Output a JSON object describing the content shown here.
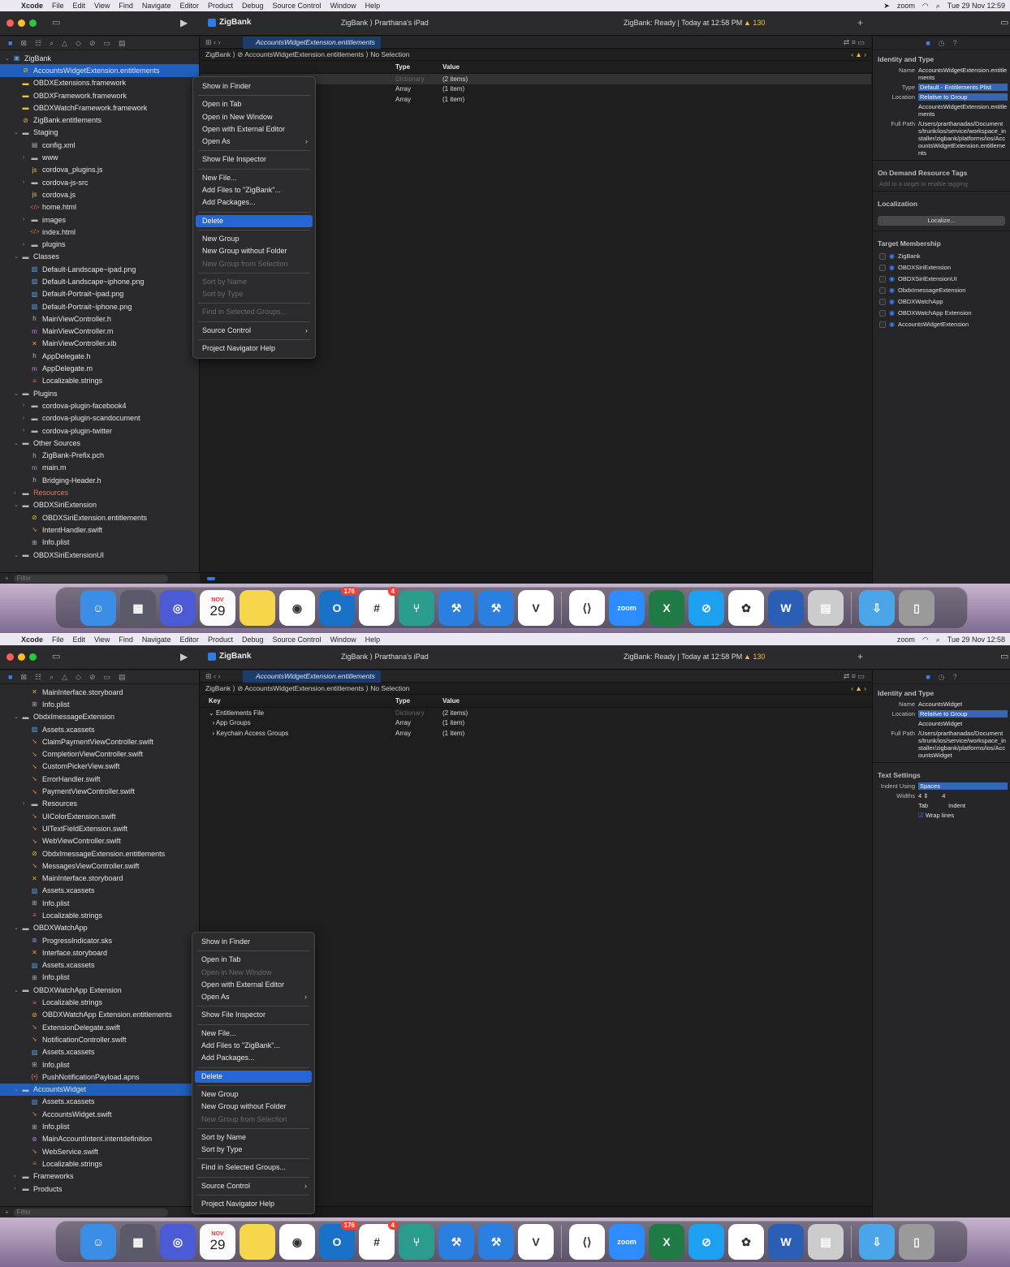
{
  "menubar": {
    "apple": "",
    "app": "Xcode",
    "items": [
      "File",
      "Edit",
      "View",
      "Find",
      "Navigate",
      "Editor",
      "Product",
      "Debug",
      "Source Control",
      "Window",
      "Help"
    ],
    "zoom": "zoom",
    "clock1": "Tue 29 Nov 12:59",
    "clock2": "Tue 29 Nov 12:58"
  },
  "toolbar": {
    "project": "ZigBank",
    "scheme": "ZigBank",
    "device": "Prarthana's iPad",
    "status": "ZigBank: Ready | Today at 12:58 PM",
    "warnings": "130"
  },
  "editor": {
    "tab": "AccountsWidgetExtension.entitlements",
    "jump": "ZigBank ⟩ ⊘ AccountsWidgetExtension.entitlements ⟩ No Selection",
    "headers": {
      "key": "Key",
      "type": "Type",
      "value": "Value"
    },
    "rows": [
      {
        "key": "Entitlements File",
        "type": "Dictionary",
        "value": "(2 items)"
      },
      {
        "key": "App Groups",
        "type": "Array",
        "value": "(1 item)"
      },
      {
        "key": "Keychain Access Groups",
        "type": "Array",
        "value": "(1 item)"
      }
    ]
  },
  "nav1": [
    {
      "t": "ZigBank",
      "i": "proj",
      "d": 0,
      "ar": "v"
    },
    {
      "t": "AccountsWidgetExtension.entitlements",
      "i": "ent",
      "d": 1,
      "sel": true
    },
    {
      "t": "OBDXExtensions.framework",
      "i": "fw",
      "d": 1
    },
    {
      "t": "OBDXFramework.framework",
      "i": "fw",
      "d": 1
    },
    {
      "t": "OBDXWatchFramework.framework",
      "i": "fw",
      "d": 1
    },
    {
      "t": "ZigBank.entitlements",
      "i": "ent",
      "d": 1
    },
    {
      "t": "Staging",
      "i": "fold",
      "d": 1,
      "ar": "v"
    },
    {
      "t": "config.xml",
      "i": "xml",
      "d": 2
    },
    {
      "t": "www",
      "i": "fold",
      "d": 2,
      "ar": ">"
    },
    {
      "t": "cordova_plugins.js",
      "i": "js",
      "d": 2
    },
    {
      "t": "cordova-js-src",
      "i": "fold",
      "d": 2,
      "ar": ">"
    },
    {
      "t": "cordova.js",
      "i": "js",
      "d": 2
    },
    {
      "t": "home.html",
      "i": "html",
      "d": 2
    },
    {
      "t": "images",
      "i": "fold",
      "d": 2,
      "ar": ">"
    },
    {
      "t": "index.html",
      "i": "html",
      "d": 2
    },
    {
      "t": "plugins",
      "i": "fold",
      "d": 2,
      "ar": ">"
    },
    {
      "t": "Classes",
      "i": "fold",
      "d": 1,
      "ar": "v"
    },
    {
      "t": "Default-Landscape~ipad.png",
      "i": "img",
      "d": 2
    },
    {
      "t": "Default-Landscape~iphone.png",
      "i": "img",
      "d": 2
    },
    {
      "t": "Default-Portrait~ipad.png",
      "i": "img",
      "d": 2
    },
    {
      "t": "Default-Portrait~iphone.png",
      "i": "img",
      "d": 2
    },
    {
      "t": "MainViewController.h",
      "i": "h",
      "d": 2
    },
    {
      "t": "MainViewController.m",
      "i": "m",
      "d": 2
    },
    {
      "t": "MainViewController.xib",
      "i": "x",
      "d": 2
    },
    {
      "t": "AppDelegate.h",
      "i": "h",
      "d": 2
    },
    {
      "t": "AppDelegate.m",
      "i": "m",
      "d": 2
    },
    {
      "t": "Localizable.strings",
      "i": "str",
      "d": 2
    },
    {
      "t": "Plugins",
      "i": "fold",
      "d": 1,
      "ar": "v"
    },
    {
      "t": "cordova-plugin-facebook4",
      "i": "fold",
      "d": 2,
      "ar": ">"
    },
    {
      "t": "cordova-plugin-scandocument",
      "i": "fold",
      "d": 2,
      "ar": ">"
    },
    {
      "t": "cordova-plugin-twitter",
      "i": "fold",
      "d": 2,
      "ar": ">"
    },
    {
      "t": "Other Sources",
      "i": "fold",
      "d": 1,
      "ar": "v"
    },
    {
      "t": "ZigBank-Prefix.pch",
      "i": "h",
      "d": 2
    },
    {
      "t": "main.m",
      "i": "m",
      "d": 2
    },
    {
      "t": "Bridging-Header.h",
      "i": "h",
      "d": 2
    },
    {
      "t": "Resources",
      "i": "fold",
      "d": 1,
      "ar": ">",
      "red": true
    },
    {
      "t": "OBDXSiriExtension",
      "i": "fold",
      "d": 1,
      "ar": "v"
    },
    {
      "t": "OBDXSiriExtension.entitlements",
      "i": "ent",
      "d": 2
    },
    {
      "t": "IntentHandler.swift",
      "i": "sw",
      "d": 2
    },
    {
      "t": "Info.plist",
      "i": "plist",
      "d": 2
    },
    {
      "t": "OBDXSiriExtensionUI",
      "i": "fold",
      "d": 1,
      "ar": "v"
    }
  ],
  "nav2": [
    {
      "t": "MainInterface.storyboard",
      "i": "x",
      "d": 2
    },
    {
      "t": "Info.plist",
      "i": "plist",
      "d": 2
    },
    {
      "t": "ObdxImessageExtension",
      "i": "fold",
      "d": 1,
      "ar": "v"
    },
    {
      "t": "Assets.xcassets",
      "i": "xc",
      "d": 2
    },
    {
      "t": "ClaimPaymentViewController.swift",
      "i": "sw",
      "d": 2
    },
    {
      "t": "CompletionViewController.swift",
      "i": "sw",
      "d": 2
    },
    {
      "t": "CustomPickerView.swift",
      "i": "sw",
      "d": 2
    },
    {
      "t": "ErrorHandler.swift",
      "i": "sw",
      "d": 2
    },
    {
      "t": "PaymentViewController.swift",
      "i": "sw",
      "d": 2
    },
    {
      "t": "Resources",
      "i": "fold",
      "d": 2,
      "ar": ">"
    },
    {
      "t": "UIColorExtension.swift",
      "i": "sw",
      "d": 2
    },
    {
      "t": "UITextFieldExtension.swift",
      "i": "sw",
      "d": 2
    },
    {
      "t": "WebViewController.swift",
      "i": "sw",
      "d": 2
    },
    {
      "t": "ObdxImessageExtension.entitlements",
      "i": "ent",
      "d": 2
    },
    {
      "t": "MessagesViewController.swift",
      "i": "sw",
      "d": 2
    },
    {
      "t": "MainInterface.storyboard",
      "i": "x",
      "d": 2
    },
    {
      "t": "Assets.xcassets",
      "i": "xc",
      "d": 2
    },
    {
      "t": "Info.plist",
      "i": "plist",
      "d": 2
    },
    {
      "t": "Localizable.strings",
      "i": "str",
      "d": 2
    },
    {
      "t": "OBDXWatchApp",
      "i": "fold",
      "d": 1,
      "ar": "v"
    },
    {
      "t": "ProgressIndicator.sks",
      "i": "int",
      "d": 2
    },
    {
      "t": "Interface.storyboard",
      "i": "x",
      "d": 2
    },
    {
      "t": "Assets.xcassets",
      "i": "xc",
      "d": 2
    },
    {
      "t": "Info.plist",
      "i": "plist",
      "d": 2
    },
    {
      "t": "OBDXWatchApp Extension",
      "i": "fold",
      "d": 1,
      "ar": "v"
    },
    {
      "t": "Localizable.strings",
      "i": "str",
      "d": 2
    },
    {
      "t": "OBDXWatchApp Extension.entitlements",
      "i": "ent",
      "d": 2
    },
    {
      "t": "ExtensionDelegate.swift",
      "i": "sw",
      "d": 2
    },
    {
      "t": "NotificationController.swift",
      "i": "sw",
      "d": 2
    },
    {
      "t": "Assets.xcassets",
      "i": "xc",
      "d": 2
    },
    {
      "t": "Info.plist",
      "i": "plist",
      "d": 2
    },
    {
      "t": "PushNotificationPayload.apns",
      "i": "apns",
      "d": 2
    },
    {
      "t": "AccountsWidget",
      "i": "fold",
      "d": 1,
      "ar": "v",
      "sel": true
    },
    {
      "t": "Assets.xcassets",
      "i": "xc",
      "d": 2
    },
    {
      "t": "AccountsWidget.swift",
      "i": "sw",
      "d": 2
    },
    {
      "t": "Info.plist",
      "i": "plist",
      "d": 2
    },
    {
      "t": "MainAccountIntent.intentdefinition",
      "i": "int",
      "d": 2
    },
    {
      "t": "WebService.swift",
      "i": "sw",
      "d": 2
    },
    {
      "t": "Localizable.strings",
      "i": "str",
      "d": 2
    },
    {
      "t": "Frameworks",
      "i": "fold",
      "d": 1,
      "ar": ">"
    },
    {
      "t": "Products",
      "i": "fold",
      "d": 1,
      "ar": ">"
    }
  ],
  "menu1": [
    {
      "t": "Show in Finder"
    },
    {
      "sep": true
    },
    {
      "t": "Open in Tab"
    },
    {
      "t": "Open in New Window"
    },
    {
      "t": "Open with External Editor"
    },
    {
      "t": "Open As",
      "sub": true
    },
    {
      "sep": true
    },
    {
      "t": "Show File Inspector"
    },
    {
      "sep": true
    },
    {
      "t": "New File..."
    },
    {
      "t": "Add Files to \"ZigBank\"..."
    },
    {
      "t": "Add Packages..."
    },
    {
      "sep": true
    },
    {
      "t": "Delete",
      "hl": true
    },
    {
      "sep": true
    },
    {
      "t": "New Group"
    },
    {
      "t": "New Group without Folder"
    },
    {
      "t": "New Group from Selection",
      "dis": true
    },
    {
      "sep": true
    },
    {
      "t": "Sort by Name",
      "dis": true
    },
    {
      "t": "Sort by Type",
      "dis": true
    },
    {
      "sep": true
    },
    {
      "t": "Find in Selected Groups...",
      "dis": true
    },
    {
      "sep": true
    },
    {
      "t": "Source Control",
      "sub": true
    },
    {
      "sep": true
    },
    {
      "t": "Project Navigator Help"
    }
  ],
  "menu2": [
    {
      "t": "Show in Finder"
    },
    {
      "sep": true
    },
    {
      "t": "Open in Tab"
    },
    {
      "t": "Open in New Window",
      "dis": true
    },
    {
      "t": "Open with External Editor"
    },
    {
      "t": "Open As",
      "sub": true
    },
    {
      "sep": true
    },
    {
      "t": "Show File Inspector"
    },
    {
      "sep": true
    },
    {
      "t": "New File..."
    },
    {
      "t": "Add Files to \"ZigBank\"..."
    },
    {
      "t": "Add Packages..."
    },
    {
      "sep": true
    },
    {
      "t": "Delete",
      "hl": true
    },
    {
      "sep": true
    },
    {
      "t": "New Group"
    },
    {
      "t": "New Group without Folder"
    },
    {
      "t": "New Group from Selection",
      "dis": true
    },
    {
      "sep": true
    },
    {
      "t": "Sort by Name"
    },
    {
      "t": "Sort by Type"
    },
    {
      "sep": true
    },
    {
      "t": "Find in Selected Groups..."
    },
    {
      "sep": true
    },
    {
      "t": "Source Control",
      "sub": true
    },
    {
      "sep": true
    },
    {
      "t": "Project Navigator Help"
    }
  ],
  "inspector1": {
    "section": "Identity and Type",
    "name_label": "Name",
    "name": "AccountsWidgetExtension.entitlements",
    "type_label": "Type",
    "type": "Default - Entitlements Plist",
    "location_label": "Location",
    "location": "Relative to Group",
    "location_file": "AccountsWidgetExtension.entitlements",
    "fullpath_label": "Full Path",
    "fullpath": "/Users/prarthanadas/Documents/trunk/ios/service/workspace_installer/zigbank/platforms/ios/AccountsWidgetExtension.entitlements",
    "odr": "On Demand Resource Tags",
    "odr_placeholder": "Add to a target to enable tagging",
    "localization": "Localization",
    "localize": "Localize...",
    "targets_title": "Target Membership",
    "targets": [
      "ZigBank",
      "OBDXSiriExtension",
      "OBDXSiriExtensionUI",
      "ObdxImessageExtension",
      "OBDXWatchApp",
      "OBDXWatchApp Extension",
      "AccountsWidgetExtension"
    ]
  },
  "inspector2": {
    "section": "Identity and Type",
    "name_label": "Name",
    "name": "AccountsWidget",
    "location_label": "Location",
    "location": "Relative to Group",
    "location_file": "AccountsWidget",
    "fullpath_label": "Full Path",
    "fullpath": "/Users/prarthanadas/Documents/trunk/ios/service/workspace_installer/zigbank/platforms/ios/AccountsWidget",
    "text_settings": "Text Settings",
    "indent_label": "Indent Using",
    "indent": "Spaces",
    "widths_label": "Widths",
    "tab_w": "4",
    "indent_w": "4",
    "tab_lbl": "Tab",
    "indent_lbl": "Indent",
    "wrap": "Wrap lines"
  },
  "navfoot": {
    "filter": "Filter"
  },
  "dock": {
    "calendar_month": "NOV",
    "calendar_day": "29",
    "outlook_badge": "176",
    "slack_badge": "4",
    "zoom": "zoom"
  }
}
